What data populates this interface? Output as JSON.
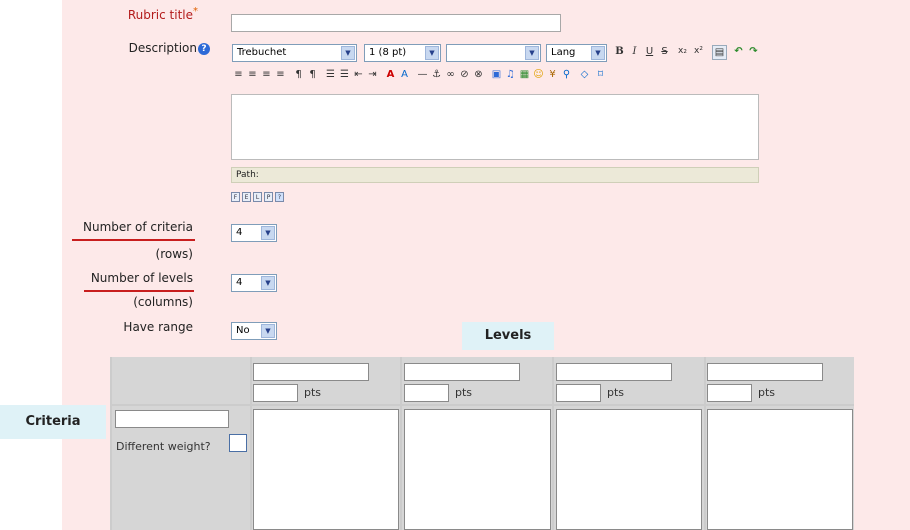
{
  "form": {
    "rubric_title_label": "Rubric title",
    "rubric_title_required": "*",
    "description_label": "Description",
    "criteria_label": "Number of criteria",
    "criteria_sub": "(rows)",
    "criteria_value": "4",
    "levels_label": "Number of levels",
    "levels_sub": "(columns)",
    "levels_value": "4",
    "range_label": "Have range",
    "range_value": "No"
  },
  "editor": {
    "font": "Trebuchet",
    "size": "1 (8 pt)",
    "style": "",
    "lang": "Lang",
    "path_label": "Path:"
  },
  "grid": {
    "levels_badge": "Levels",
    "criteria_badge": "Criteria",
    "pts_label": "pts",
    "weight_label": "Different weight?"
  },
  "colors": {
    "panel_bg": "#fde9e9",
    "required_label": "#b31b1b",
    "underline": "#c81e1e",
    "badge_bg": "#dff2f7"
  },
  "icons": [
    "bold-icon",
    "italic-icon",
    "underline-icon",
    "strikethrough-icon",
    "subscript-icon",
    "superscript-icon",
    "paste-icon",
    "undo-icon",
    "redo-icon",
    "align-left-icon",
    "align-center-icon",
    "align-right-icon",
    "justify-icon",
    "ltr-icon",
    "rtl-icon",
    "ordered-list-icon",
    "unordered-list-icon",
    "outdent-icon",
    "indent-icon",
    "text-color-icon",
    "background-color-icon",
    "hr-icon",
    "anchor-icon",
    "link-icon",
    "unlink-icon",
    "nolink-icon",
    "image-icon",
    "media-icon",
    "insert-table-icon",
    "smiley-icon",
    "special-char-icon",
    "search-replace-icon",
    "html-source-icon",
    "fullscreen-icon"
  ]
}
